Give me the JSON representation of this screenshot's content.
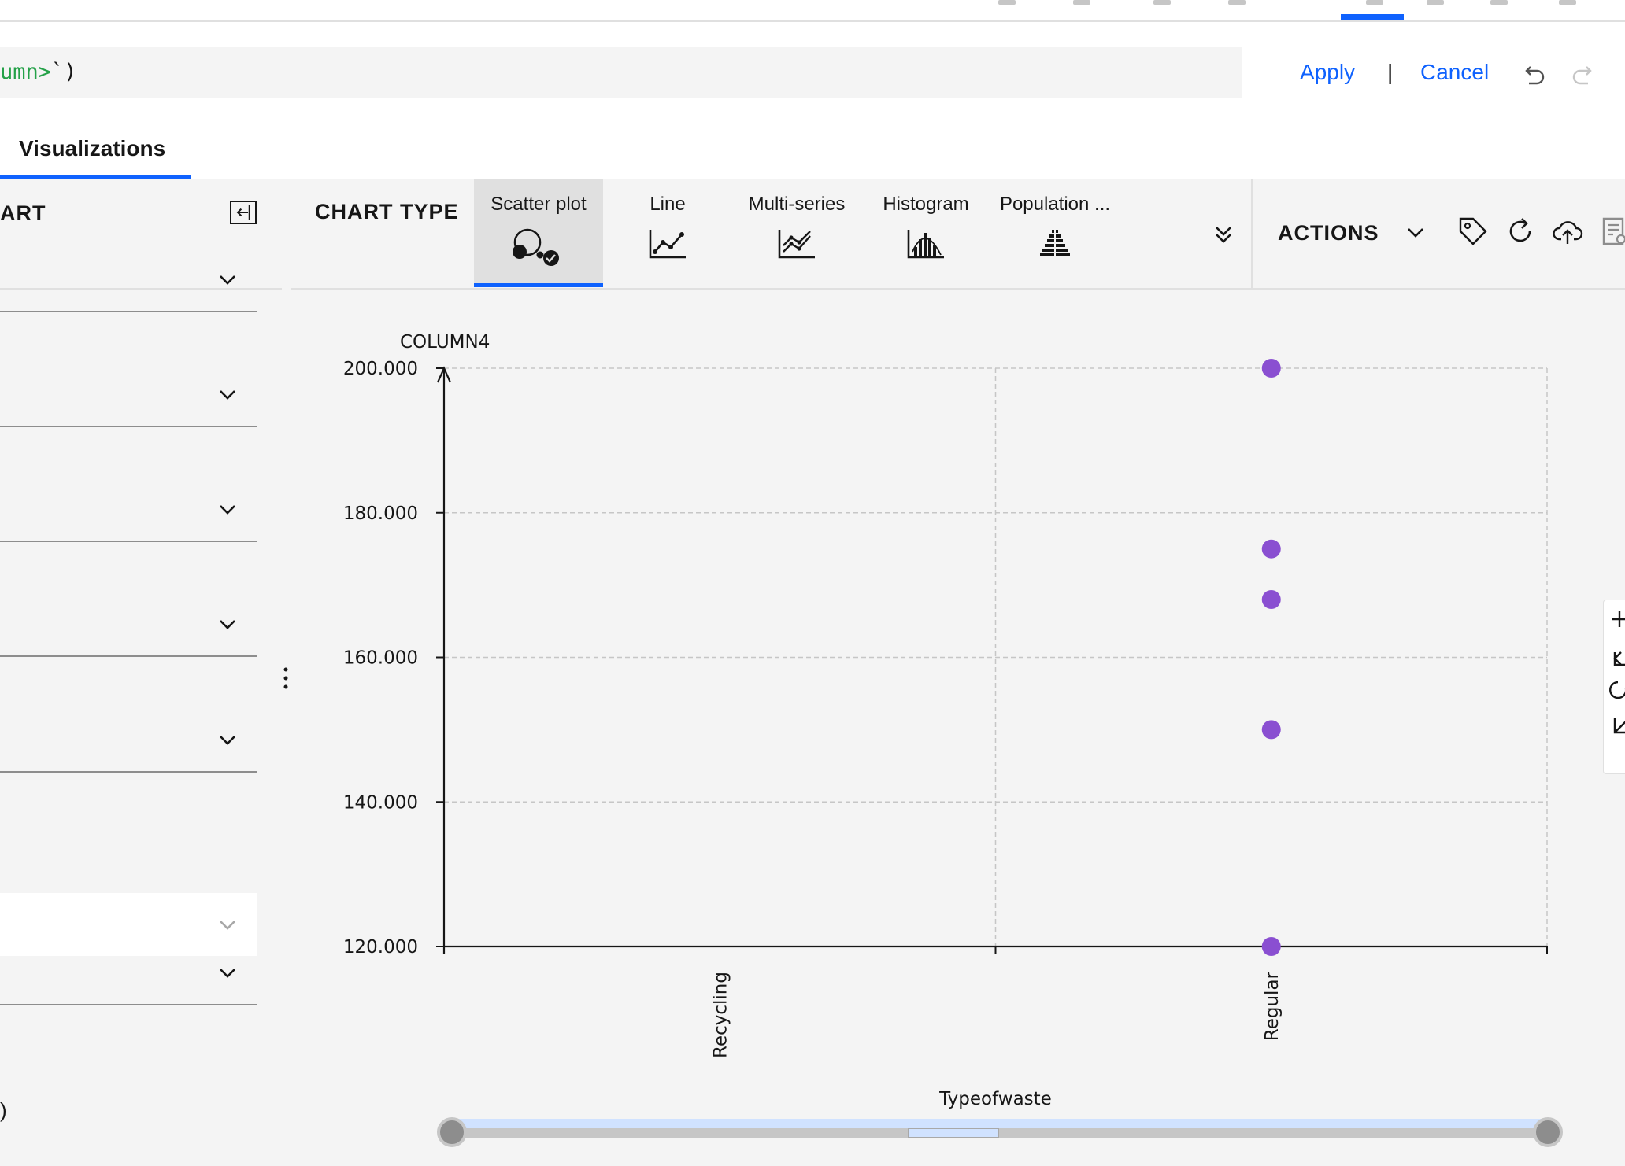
{
  "expression": {
    "text_prefix": "umn>",
    "text_suffix": "`)"
  },
  "header_actions": {
    "apply": "Apply",
    "separator": "|",
    "cancel": "Cancel"
  },
  "tabs": {
    "visualizations": "Visualizations"
  },
  "left_panel": {
    "title": "ART",
    "dropdown_count": 7,
    "trailing_text": ")"
  },
  "chart_toolbar": {
    "label": "CHART TYPE",
    "types": [
      {
        "label": "Scatter plot",
        "icon": "scatter-plot-icon",
        "selected": true
      },
      {
        "label": "Line",
        "icon": "line-chart-icon",
        "selected": false
      },
      {
        "label": "Multi-series",
        "icon": "multi-series-icon",
        "selected": false
      },
      {
        "label": "Histogram",
        "icon": "histogram-icon",
        "selected": false
      },
      {
        "label": "Population ...",
        "icon": "population-pyramid-icon",
        "selected": false
      }
    ],
    "actions_label": "ACTIONS"
  },
  "colors": {
    "accent": "#0f62fe",
    "point": "#8a4fd1"
  },
  "chart_data": {
    "type": "scatter",
    "title": "",
    "xlabel": "Typeofwaste",
    "ylabel": "COLUMN4",
    "categories": [
      "Recycling",
      "Regular"
    ],
    "ylim": [
      120,
      200
    ],
    "y_ticks": [
      "120.000",
      "140.000",
      "160.000",
      "180.000",
      "200.000"
    ],
    "grid": true,
    "points": [
      {
        "x": "Regular",
        "y": 200
      },
      {
        "x": "Regular",
        "y": 175
      },
      {
        "x": "Regular",
        "y": 168
      },
      {
        "x": "Regular",
        "y": 150
      },
      {
        "x": "Regular",
        "y": 120
      }
    ]
  }
}
